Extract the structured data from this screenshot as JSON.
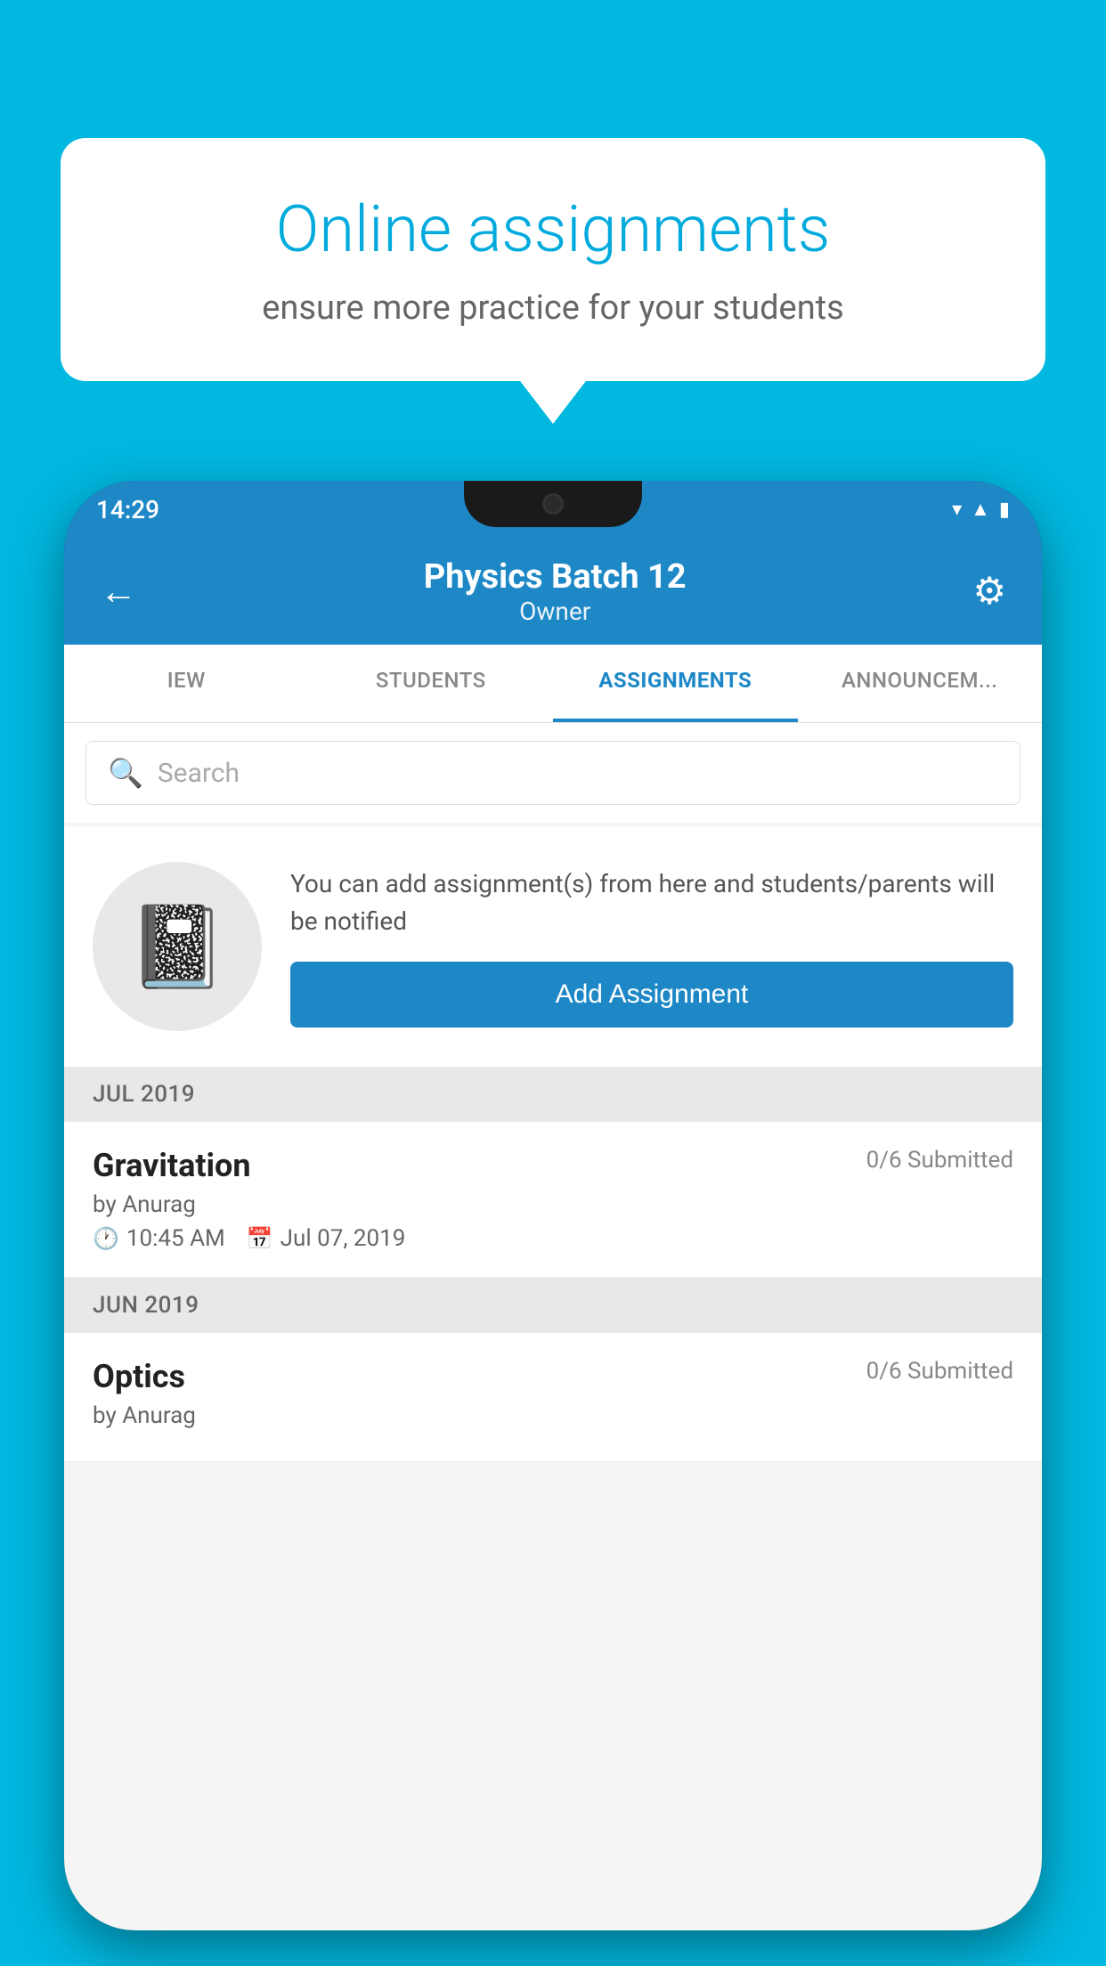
{
  "background": {
    "color": "#00b8e0"
  },
  "speech_bubble": {
    "title": "Online assignments",
    "subtitle": "ensure more practice for your students"
  },
  "status_bar": {
    "time": "14:29",
    "wifi_icon": "▾",
    "signal_icon": "▲",
    "battery_icon": "▮"
  },
  "app_bar": {
    "back_icon": "←",
    "title": "Physics Batch 12",
    "subtitle": "Owner",
    "settings_icon": "⚙"
  },
  "tabs": [
    {
      "label": "IEW",
      "active": false
    },
    {
      "label": "STUDENTS",
      "active": false
    },
    {
      "label": "ASSIGNMENTS",
      "active": true
    },
    {
      "label": "ANNOUNCEM...",
      "active": false
    }
  ],
  "search": {
    "placeholder": "Search",
    "icon": "🔍"
  },
  "empty_state": {
    "description": "You can add assignment(s) from here and students/parents will be notified",
    "button_label": "Add Assignment",
    "icon": "📓"
  },
  "sections": [
    {
      "header": "JUL 2019",
      "assignments": [
        {
          "name": "Gravitation",
          "submitted": "0/6 Submitted",
          "author": "by Anurag",
          "time": "10:45 AM",
          "date": "Jul 07, 2019"
        }
      ]
    },
    {
      "header": "JUN 2019",
      "assignments": [
        {
          "name": "Optics",
          "submitted": "0/6 Submitted",
          "author": "by Anurag",
          "time": "",
          "date": ""
        }
      ]
    }
  ]
}
